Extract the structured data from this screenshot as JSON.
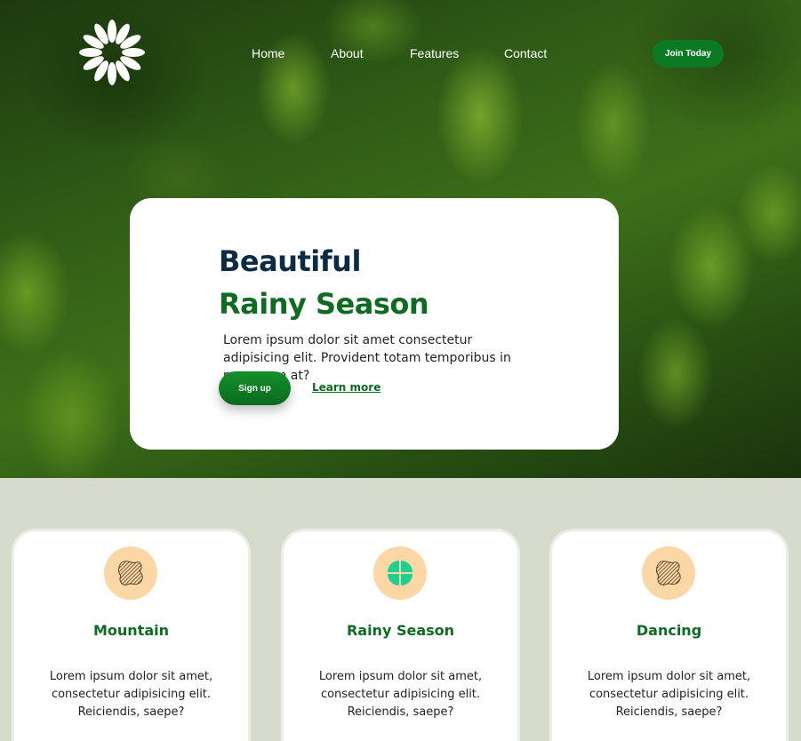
{
  "nav": {
    "items": [
      {
        "label": "Home"
      },
      {
        "label": "About"
      },
      {
        "label": "Features"
      },
      {
        "label": "Contact"
      }
    ],
    "join_label": "Join Today"
  },
  "hero": {
    "title_line1": "Beautiful",
    "title_line2": "Rainy Season",
    "description": "Lorem ipsum dolor sit amet consectetur adipisicing elit. Provident totam temporibus in numquam at?",
    "signup_label": "Sign up",
    "learn_label": "Learn more"
  },
  "cards": [
    {
      "title": "Mountain",
      "text": "Lorem ipsum dolor sit amet, consectetur adipisicing elit. Reiciendis, saepe?",
      "icon": "abstract-shape-icon"
    },
    {
      "title": "Rainy Season",
      "text": "Lorem ipsum dolor sit amet, consectetur adipisicing elit. Reiciendis, saepe?",
      "icon": "clover-icon"
    },
    {
      "title": "Dancing",
      "text": "Lorem ipsum dolor sit amet, consectetur adipisicing elit. Reiciendis, saepe?",
      "icon": "abstract-shape-icon"
    }
  ],
  "colors": {
    "accent_green": "#0d6b22",
    "dark_title": "#0d2b45",
    "section_bg": "#d7dbcd",
    "icon_bg": "#fbd7a5",
    "clover": "#1fcf8f"
  }
}
